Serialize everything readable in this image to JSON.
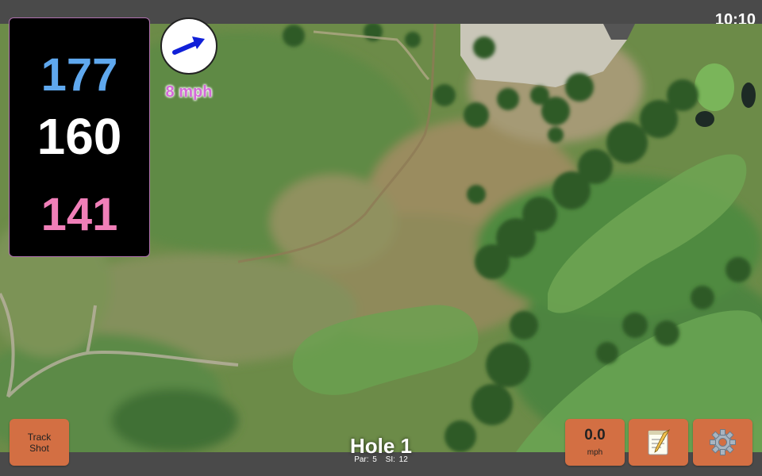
{
  "status": {
    "clock": "10:10"
  },
  "distances": {
    "back": "177",
    "middle": "160",
    "front": "141"
  },
  "wind": {
    "speed": "8 mph",
    "icon": "wind-arrow-icon",
    "arrow_color": "#1020d8"
  },
  "buttons": {
    "track_shot_line1": "Track",
    "track_shot_line2": "Shot",
    "speed_value": "0.0",
    "speed_unit": "mph",
    "notes_icon": "notepad-icon",
    "settings_icon": "gear-icon"
  },
  "hole": {
    "title": "Hole 1",
    "par": "Par: 5",
    "si": "SI: 12"
  },
  "colors": {
    "back_yardage": "#5fa8ee",
    "middle_yardage": "#ffffff",
    "front_yardage": "#f07fb8",
    "button": "#d36f43",
    "wind_text": "#d46ad8"
  }
}
